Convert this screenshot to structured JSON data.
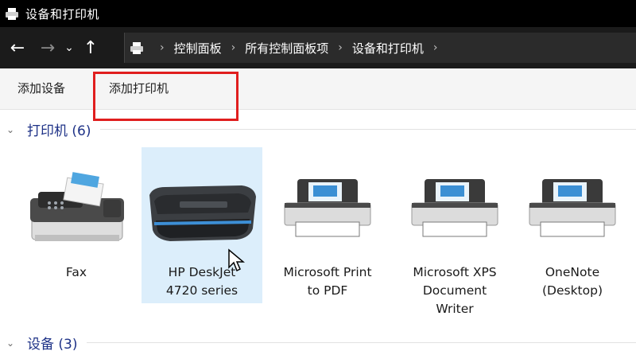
{
  "window": {
    "title": "设备和打印机"
  },
  "nav": {
    "back_icon": "arrow-left-icon",
    "forward_icon": "arrow-right-icon",
    "recent_icon": "chevron-down-icon",
    "up_icon": "arrow-up-icon"
  },
  "breadcrumb": {
    "items": [
      "控制面板",
      "所有控制面板项",
      "设备和打印机"
    ],
    "separator": "›"
  },
  "toolbar": {
    "add_device": "添加设备",
    "add_printer": "添加打印机"
  },
  "sections": {
    "printers": {
      "label": "打印机 (6)"
    },
    "devices": {
      "label": "设备 (3)"
    }
  },
  "printers": [
    {
      "name": "Fax",
      "icon": "fax-icon"
    },
    {
      "name": "HP DeskJet\n4720 series",
      "icon": "inkjet-printer-icon",
      "selected": true
    },
    {
      "name": "Microsoft Print\nto PDF",
      "icon": "printer-icon"
    },
    {
      "name": "Microsoft XPS\nDocument\nWriter",
      "icon": "printer-icon"
    },
    {
      "name": "OneNote\n(Desktop)",
      "icon": "printer-icon"
    }
  ],
  "colors": {
    "highlight": "#e01e1e",
    "selection": "#dceefb",
    "section_text": "#1e3287"
  }
}
